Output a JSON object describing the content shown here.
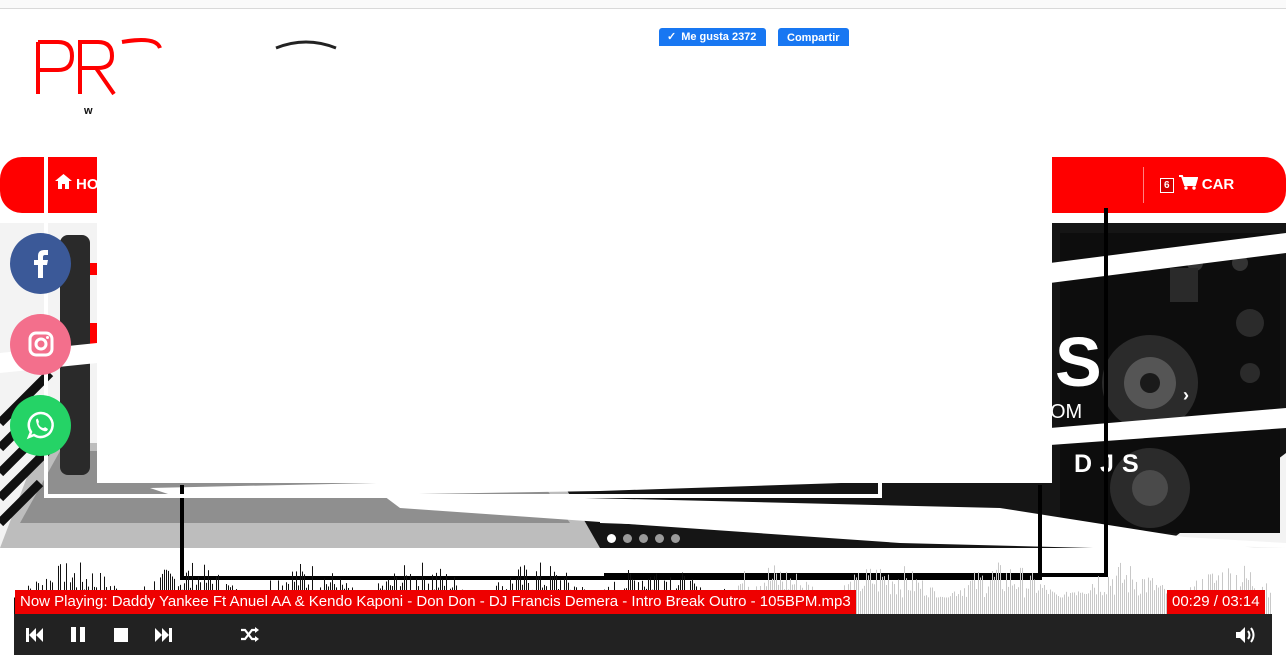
{
  "facebook_widget": {
    "like_label": "Me gusta 2372",
    "share_label": "Compartir"
  },
  "nav": {
    "home_label": "HO",
    "cart_count": "6",
    "cart_label": "CAR"
  },
  "slider": {
    "slogan_partial": "DJS",
    "dots_total": 5,
    "active_dot": 1,
    "next_icon": "chevron-right-icon"
  },
  "social": [
    "facebook-icon",
    "instagram-icon",
    "whatsapp-icon"
  ],
  "player": {
    "now_playing": "Now Playing: Daddy Yankee Ft Anuel AA & Kendo Kaponi - Don Don - DJ Francis Demera - Intro Break Outro - 105BPM.mp3",
    "time": "00:29 / 03:14",
    "progress": 0.149,
    "controls": [
      "previous-icon",
      "pause-icon",
      "stop-icon",
      "next-icon",
      "shuffle-icon",
      "volume-icon"
    ]
  },
  "colors": {
    "brand_red": "#ff0000",
    "facebook_blue": "#1877f2",
    "player_bg": "#222222"
  }
}
